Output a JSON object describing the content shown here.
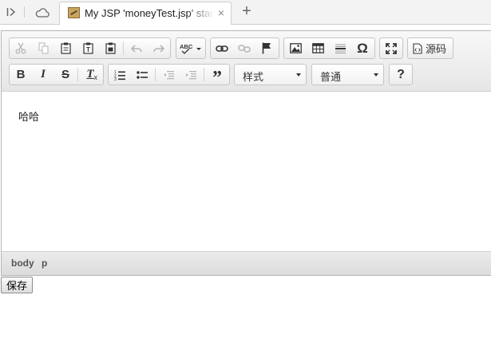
{
  "browser": {
    "tab_title": "My JSP 'moneyTest.jsp' starting page",
    "close_glyph": "×",
    "new_tab_glyph": "+"
  },
  "toolbar": {
    "row1": {
      "clipboard": [
        "cut-icon",
        "copy-icon",
        "paste-icon",
        "paste-text-icon",
        "paste-from-word-icon"
      ],
      "undo_redo": [
        "undo-icon",
        "redo-icon"
      ],
      "spellcheck_label": "ABC",
      "links": [
        "link-icon",
        "unlink-icon",
        "anchor-icon"
      ],
      "insert": [
        "image-icon",
        "table-icon",
        "horizontal-rule-icon",
        "special-char-icon"
      ],
      "special_char_glyph": "Ω",
      "maximize_icon": "maximize-icon",
      "source_label": "源码"
    },
    "row2": {
      "bold": "B",
      "italic": "I",
      "strike": "S",
      "remove_format": "T",
      "lists": [
        "numbered-list-icon",
        "bulleted-list-icon"
      ],
      "indent": [
        "outdent-icon",
        "indent-icon"
      ],
      "blockquote_glyph": "”",
      "styles_value": "样式",
      "format_value": "普通",
      "help_glyph": "?"
    }
  },
  "content": {
    "text": "哈哈"
  },
  "elements_path": [
    "body",
    "p"
  ],
  "save_label": "保存"
}
